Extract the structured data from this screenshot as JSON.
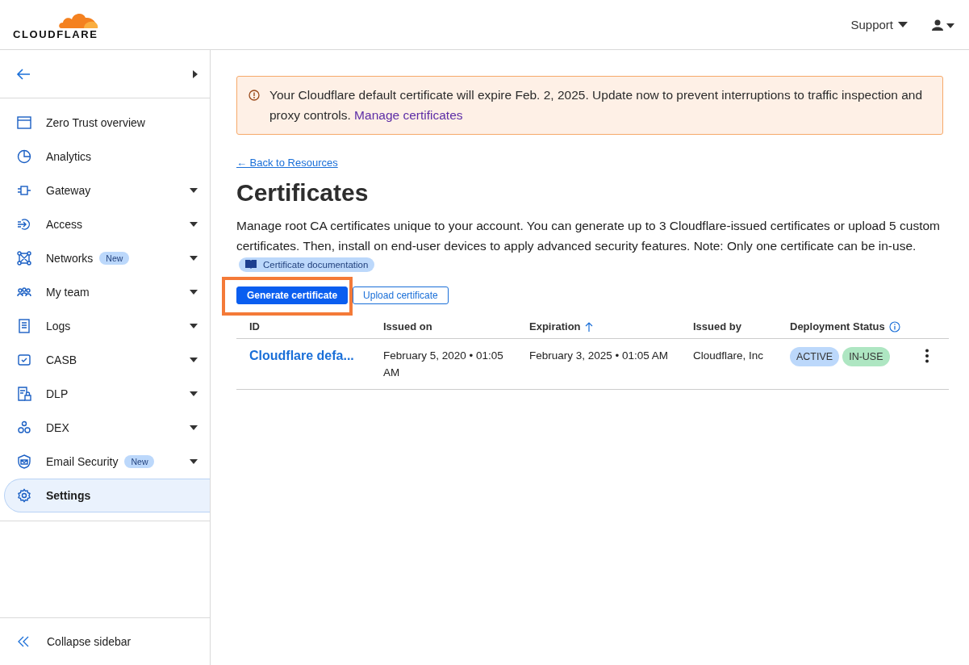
{
  "header": {
    "logo_text": "CLOUDFLARE",
    "support": "Support"
  },
  "sidebar": {
    "items": [
      {
        "label": "Zero Trust overview",
        "expandable": false,
        "selected": false
      },
      {
        "label": "Analytics",
        "expandable": false,
        "selected": false
      },
      {
        "label": "Gateway",
        "expandable": true,
        "selected": false
      },
      {
        "label": "Access",
        "expandable": true,
        "selected": false
      },
      {
        "label": "Networks",
        "badge": "New",
        "expandable": true,
        "selected": false
      },
      {
        "label": "My team",
        "expandable": true,
        "selected": false
      },
      {
        "label": "Logs",
        "expandable": true,
        "selected": false
      },
      {
        "label": "CASB",
        "expandable": true,
        "selected": false
      },
      {
        "label": "DLP",
        "expandable": true,
        "selected": false
      },
      {
        "label": "DEX",
        "expandable": true,
        "selected": false
      },
      {
        "label": "Email Security",
        "badge": "New",
        "expandable": true,
        "selected": false
      },
      {
        "label": "Settings",
        "expandable": false,
        "selected": true
      }
    ],
    "collapse": "Collapse sidebar"
  },
  "alert": {
    "text": "Your Cloudflare default certificate will expire Feb. 2, 2025. Update now to prevent interruptions to traffic inspection and proxy controls.",
    "link": "Manage certificates"
  },
  "back_link": "← Back to Resources",
  "title": "Certificates",
  "description": "Manage root CA certificates unique to your account. You can generate up to 3 Cloudflare-issued certificates or upload 5 custom certificates. Then, install on end-user devices to apply advanced security features. Note: Only one certificate can be in-use.",
  "doc_link": "Certificate documentation",
  "buttons": [
    {
      "label": "Generate certificate",
      "kind": "primary",
      "highlighted": true
    },
    {
      "label": "Upload certificate",
      "kind": "secondary"
    }
  ],
  "table": {
    "columns": [
      {
        "label": "ID"
      },
      {
        "label": "Issued on"
      },
      {
        "label": "Expiration",
        "sorted": true
      },
      {
        "label": "Issued by"
      },
      {
        "label": "Deployment Status",
        "info": true
      }
    ],
    "rows": [
      {
        "id": "Cloudflare defa...",
        "issued_on": "February 5, 2020 • 01:05 AM",
        "expiration": "February 3, 2025 • 01:05 AM",
        "issued_by": "Cloudflare, Inc",
        "statuses": [
          {
            "label": "ACTIVE",
            "color": "#bcd8fb"
          },
          {
            "label": "IN-USE",
            "color": "#aee6c2"
          }
        ]
      }
    ]
  }
}
